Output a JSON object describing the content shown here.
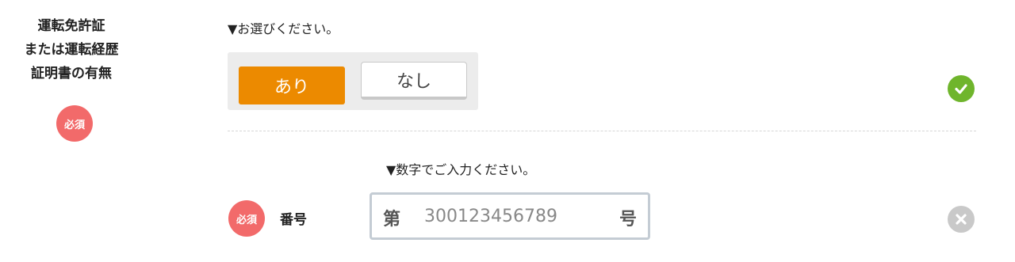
{
  "license": {
    "label_lines": [
      "運転免許証",
      "または運転経歴",
      "証明書の有無"
    ],
    "required_badge": "必須",
    "instruction": "▼お選びください。",
    "options": {
      "yes": "あり",
      "no": "なし"
    },
    "selected": "あり",
    "status_icon": "check-circle-icon"
  },
  "number": {
    "instruction": "▼数字でご入力ください。",
    "required_badge": "必須",
    "label": "番号",
    "prefix": "第",
    "suffix": "号",
    "placeholder": "300123456789",
    "value": "",
    "status_icon": "clear-circle-icon"
  },
  "colors": {
    "accent_orange": "#ec8a00",
    "required_red": "#f26a6a",
    "valid_green": "#6fb52c",
    "clear_gray": "#c9c9c9"
  }
}
